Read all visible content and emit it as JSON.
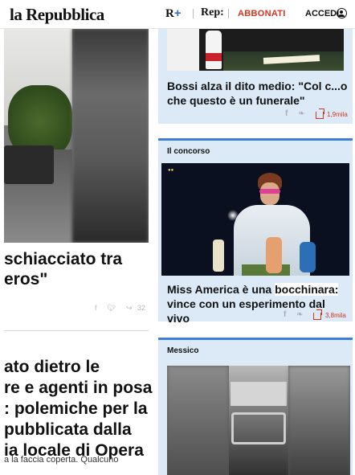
{
  "header": {
    "logo": "la Repubblica",
    "rplus_r": "R",
    "rplus_plus": "+",
    "rep": "Rep:",
    "abbonati": "ABBONATI",
    "accedi": "ACCEDI"
  },
  "left": {
    "article1_title": "schiacciato tra\neros\"",
    "article1_share_count": "32",
    "article2_title": "ato dietro le\nre e agenti in posa\n: polemiche per la\npubblicata dalla\nia locale di Opera",
    "article2_snippet": "a la faccia coperta. Qualcuno"
  },
  "right": {
    "card1": {
      "title": "Bossi alza il dito medio: \"Col c...o\nche questo è un funerale\"",
      "share_count": "1,9mila"
    },
    "card2": {
      "section_label": "Il concorso",
      "title_part1": "Miss America è una ",
      "title_highlight": "bocchinara:",
      "title_part2": "\nvince con un esperimento dal vivo",
      "share_count": "3,8mila"
    },
    "card3": {
      "section_label": "Messico"
    }
  },
  "colors": {
    "accent_red": "#d6331f",
    "card_bg": "#dce9f7",
    "card_border": "#3b7dd8"
  }
}
